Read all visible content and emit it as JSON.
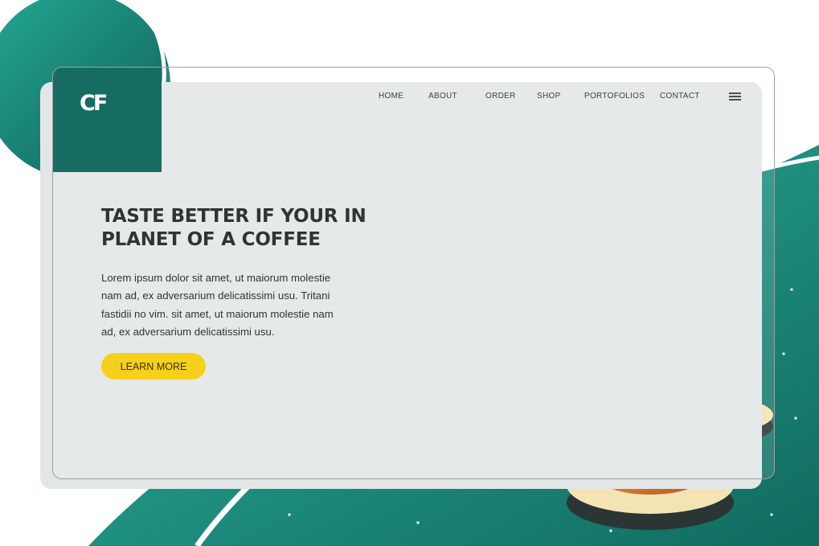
{
  "logo": {
    "text": "CF"
  },
  "nav": {
    "items": [
      {
        "label": "HOME"
      },
      {
        "label": "ABOUT"
      },
      {
        "label": "ORDER"
      },
      {
        "label": "SHOP"
      },
      {
        "label": "PORTOFOLIOS"
      },
      {
        "label": "CONTACT"
      }
    ],
    "menu_icon": "hamburger-menu-icon"
  },
  "hero": {
    "headline": "TASTE BETTER IF YOUR IN PLANET OF A COFFEE",
    "body": "Lorem ipsum dolor sit amet, ut maiorum molestie nam ad, ex adversarium delicatissimi usu. Tritani fastidii no vim. sit amet, ut maiorum molestie nam ad, ex adversarium delicatissimi usu.",
    "cta_label": "LEARN MORE"
  },
  "colors": {
    "teal_dark": "#166c62",
    "teal": "#21a08f",
    "cream": "#f4e4b4",
    "orange": "#e48a37",
    "coffee_red": "#9b2036",
    "cta_yellow": "#f6d11b",
    "text_dark": "#2f3434"
  }
}
